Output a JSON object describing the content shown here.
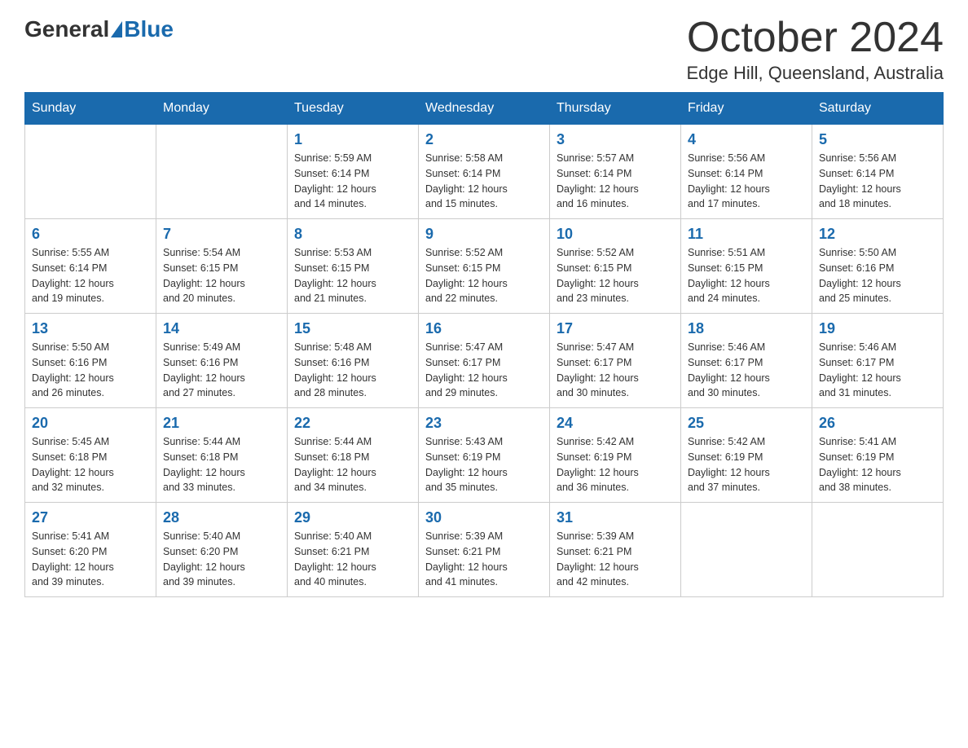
{
  "logo": {
    "general": "General",
    "blue": "Blue"
  },
  "title": "October 2024",
  "location": "Edge Hill, Queensland, Australia",
  "days_of_week": [
    "Sunday",
    "Monday",
    "Tuesday",
    "Wednesday",
    "Thursday",
    "Friday",
    "Saturday"
  ],
  "weeks": [
    [
      {
        "day": "",
        "info": ""
      },
      {
        "day": "",
        "info": ""
      },
      {
        "day": "1",
        "info": "Sunrise: 5:59 AM\nSunset: 6:14 PM\nDaylight: 12 hours\nand 14 minutes."
      },
      {
        "day": "2",
        "info": "Sunrise: 5:58 AM\nSunset: 6:14 PM\nDaylight: 12 hours\nand 15 minutes."
      },
      {
        "day": "3",
        "info": "Sunrise: 5:57 AM\nSunset: 6:14 PM\nDaylight: 12 hours\nand 16 minutes."
      },
      {
        "day": "4",
        "info": "Sunrise: 5:56 AM\nSunset: 6:14 PM\nDaylight: 12 hours\nand 17 minutes."
      },
      {
        "day": "5",
        "info": "Sunrise: 5:56 AM\nSunset: 6:14 PM\nDaylight: 12 hours\nand 18 minutes."
      }
    ],
    [
      {
        "day": "6",
        "info": "Sunrise: 5:55 AM\nSunset: 6:14 PM\nDaylight: 12 hours\nand 19 minutes."
      },
      {
        "day": "7",
        "info": "Sunrise: 5:54 AM\nSunset: 6:15 PM\nDaylight: 12 hours\nand 20 minutes."
      },
      {
        "day": "8",
        "info": "Sunrise: 5:53 AM\nSunset: 6:15 PM\nDaylight: 12 hours\nand 21 minutes."
      },
      {
        "day": "9",
        "info": "Sunrise: 5:52 AM\nSunset: 6:15 PM\nDaylight: 12 hours\nand 22 minutes."
      },
      {
        "day": "10",
        "info": "Sunrise: 5:52 AM\nSunset: 6:15 PM\nDaylight: 12 hours\nand 23 minutes."
      },
      {
        "day": "11",
        "info": "Sunrise: 5:51 AM\nSunset: 6:15 PM\nDaylight: 12 hours\nand 24 minutes."
      },
      {
        "day": "12",
        "info": "Sunrise: 5:50 AM\nSunset: 6:16 PM\nDaylight: 12 hours\nand 25 minutes."
      }
    ],
    [
      {
        "day": "13",
        "info": "Sunrise: 5:50 AM\nSunset: 6:16 PM\nDaylight: 12 hours\nand 26 minutes."
      },
      {
        "day": "14",
        "info": "Sunrise: 5:49 AM\nSunset: 6:16 PM\nDaylight: 12 hours\nand 27 minutes."
      },
      {
        "day": "15",
        "info": "Sunrise: 5:48 AM\nSunset: 6:16 PM\nDaylight: 12 hours\nand 28 minutes."
      },
      {
        "day": "16",
        "info": "Sunrise: 5:47 AM\nSunset: 6:17 PM\nDaylight: 12 hours\nand 29 minutes."
      },
      {
        "day": "17",
        "info": "Sunrise: 5:47 AM\nSunset: 6:17 PM\nDaylight: 12 hours\nand 30 minutes."
      },
      {
        "day": "18",
        "info": "Sunrise: 5:46 AM\nSunset: 6:17 PM\nDaylight: 12 hours\nand 30 minutes."
      },
      {
        "day": "19",
        "info": "Sunrise: 5:46 AM\nSunset: 6:17 PM\nDaylight: 12 hours\nand 31 minutes."
      }
    ],
    [
      {
        "day": "20",
        "info": "Sunrise: 5:45 AM\nSunset: 6:18 PM\nDaylight: 12 hours\nand 32 minutes."
      },
      {
        "day": "21",
        "info": "Sunrise: 5:44 AM\nSunset: 6:18 PM\nDaylight: 12 hours\nand 33 minutes."
      },
      {
        "day": "22",
        "info": "Sunrise: 5:44 AM\nSunset: 6:18 PM\nDaylight: 12 hours\nand 34 minutes."
      },
      {
        "day": "23",
        "info": "Sunrise: 5:43 AM\nSunset: 6:19 PM\nDaylight: 12 hours\nand 35 minutes."
      },
      {
        "day": "24",
        "info": "Sunrise: 5:42 AM\nSunset: 6:19 PM\nDaylight: 12 hours\nand 36 minutes."
      },
      {
        "day": "25",
        "info": "Sunrise: 5:42 AM\nSunset: 6:19 PM\nDaylight: 12 hours\nand 37 minutes."
      },
      {
        "day": "26",
        "info": "Sunrise: 5:41 AM\nSunset: 6:19 PM\nDaylight: 12 hours\nand 38 minutes."
      }
    ],
    [
      {
        "day": "27",
        "info": "Sunrise: 5:41 AM\nSunset: 6:20 PM\nDaylight: 12 hours\nand 39 minutes."
      },
      {
        "day": "28",
        "info": "Sunrise: 5:40 AM\nSunset: 6:20 PM\nDaylight: 12 hours\nand 39 minutes."
      },
      {
        "day": "29",
        "info": "Sunrise: 5:40 AM\nSunset: 6:21 PM\nDaylight: 12 hours\nand 40 minutes."
      },
      {
        "day": "30",
        "info": "Sunrise: 5:39 AM\nSunset: 6:21 PM\nDaylight: 12 hours\nand 41 minutes."
      },
      {
        "day": "31",
        "info": "Sunrise: 5:39 AM\nSunset: 6:21 PM\nDaylight: 12 hours\nand 42 minutes."
      },
      {
        "day": "",
        "info": ""
      },
      {
        "day": "",
        "info": ""
      }
    ]
  ]
}
